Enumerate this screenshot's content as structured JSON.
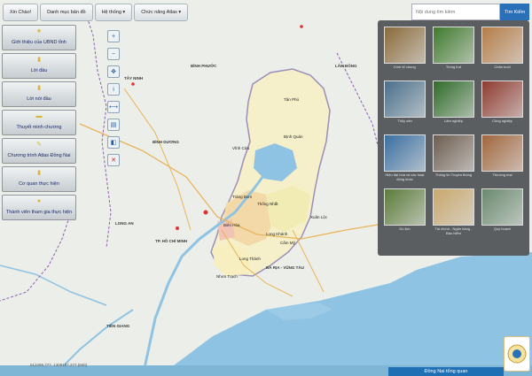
{
  "topmenu": [
    {
      "label": "Xin Chào!"
    },
    {
      "label": "Danh mục bản đồ"
    },
    {
      "label": "Hệ thống ▾"
    },
    {
      "label": "Chức năng Atlas ▾"
    }
  ],
  "leftmenu": [
    {
      "label": "Giới thiệu của UBND tỉnh",
      "icon": "star-icon"
    },
    {
      "label": "Lời đầu",
      "icon": "document-icon"
    },
    {
      "label": "Lời nói đầu",
      "icon": "document-icon"
    },
    {
      "label": "Thuyết minh chương",
      "icon": "book-icon"
    },
    {
      "label": "Chương trình Atlas Đồng Nai",
      "icon": "pencil-icon"
    },
    {
      "label": "Cơ quan thực hiện",
      "icon": "document-icon"
    },
    {
      "label": "Thành viên tham gia thực hiện",
      "icon": "people-icon"
    }
  ],
  "tools": [
    "zoom-in-icon",
    "zoom-out-icon",
    "pan-icon",
    "info-icon",
    "measure-icon",
    "print-icon",
    "layers-icon",
    "clear-icon"
  ],
  "search": {
    "placeholder": "Nội dung tìm kiếm",
    "button": "Tìm Kiếm"
  },
  "categories": [
    {
      "label": "Kinh tế chung",
      "color": "#8a6b3a"
    },
    {
      "label": "Trồng trọt",
      "color": "#3f7a2c"
    },
    {
      "label": "Chăn nuôi",
      "color": "#b57d48"
    },
    {
      "label": "Thủy sản",
      "color": "#4a6f8a"
    },
    {
      "label": "Lâm nghiệp",
      "color": "#2f6b2a"
    },
    {
      "label": "Công nghiệp",
      "color": "#8e3b2f"
    },
    {
      "label": "Hiện đại hóa và các hoạt động khác",
      "color": "#3a6fa1"
    },
    {
      "label": "Thông tin Truyền thông",
      "color": "#6c5d4f"
    },
    {
      "label": "Thương mại",
      "color": "#a1663d"
    },
    {
      "label": "Du lịch",
      "color": "#5b7c3a"
    },
    {
      "label": "Tài chính - Ngân hàng - Bảo hiểm",
      "color": "#c9a86c"
    },
    {
      "label": "Quy hoạch",
      "color": "#6a8a6f"
    }
  ],
  "map": {
    "provinces": [
      {
        "label": "BÌNH PHƯỚC"
      },
      {
        "label": "LÂM ĐỒNG"
      },
      {
        "label": "TÂY NINH"
      },
      {
        "label": "BÌNH DƯƠNG"
      },
      {
        "label": "LONG AN"
      },
      {
        "label": "TP. HỒ CHÍ MINH"
      },
      {
        "label": "TIỀN GIANG"
      },
      {
        "label": "BÀ RỊA - VŨNG TÀU"
      },
      {
        "label": "BÌNH THUẬN"
      }
    ],
    "districts": [
      {
        "label": "Tân Phú"
      },
      {
        "label": "Định Quán"
      },
      {
        "label": "Vĩnh Cửu"
      },
      {
        "label": "Trảng Bom"
      },
      {
        "label": "Thống Nhất"
      },
      {
        "label": "Biên Hòa"
      },
      {
        "label": "Xuân Lộc"
      },
      {
        "label": "Long Khánh"
      },
      {
        "label": "Cẩm Mỹ"
      },
      {
        "label": "Long Thành"
      },
      {
        "label": "Nhơn Trạch"
      }
    ]
  },
  "bottom": {
    "title": "Đồng Nai tổng quan"
  },
  "coords": "512289.777, 1309187.277 (Mét)"
}
